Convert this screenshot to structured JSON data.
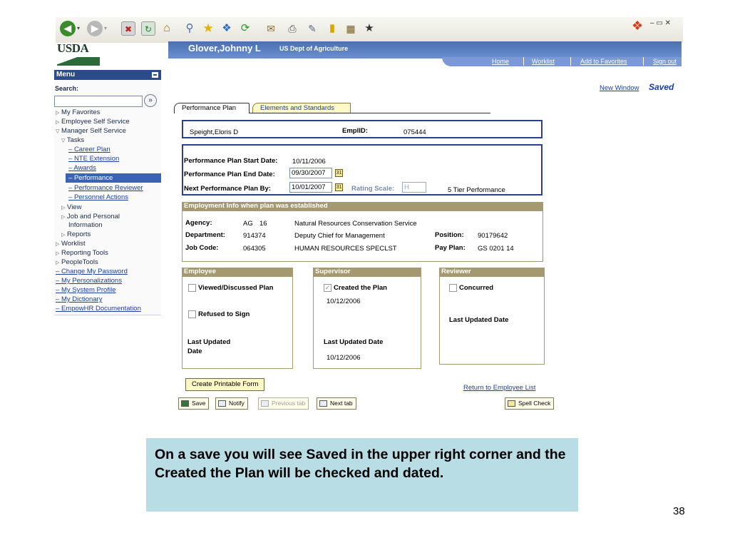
{
  "browser": {
    "back_label": "Back",
    "forward_label": "Forward"
  },
  "header": {
    "logo_text": "USDA",
    "user_name": "Glover,Johnny L",
    "org": "US Dept of Agriculture",
    "nav": [
      "Home",
      "Worklist",
      "Add to Favorites",
      "Sign out"
    ]
  },
  "menu": {
    "title": "Menu",
    "search_label": "Search:",
    "search_value": "",
    "items": {
      "my_favorites": "My Favorites",
      "employee_self_service": "Employee Self Service",
      "manager_self_service": "Manager Self Service",
      "tasks": "Tasks",
      "career_plan": "Career Plan",
      "nte_extension": "NTE Extension",
      "awards": "Awards",
      "performance": "Performance",
      "performance_reviewer": "Performance Reviewer",
      "personnel_actions": "Personnel Actions",
      "view": "View",
      "job_personal_1": "Job and Personal",
      "job_personal_2": "Information",
      "reports": "Reports",
      "worklist": "Worklist",
      "reporting_tools": "Reporting Tools",
      "peopletools": "PeopleTools",
      "change_password": "Change My Password",
      "my_personalizations": "My Personalizations",
      "my_system_profile": "My System Profile",
      "my_dictionary": "My Dictionary",
      "empowhr_doc": "EmpowHR Documentation"
    }
  },
  "top_right": {
    "new_window": "New Window",
    "saved": "Saved"
  },
  "tabs": {
    "performance_plan": "Performance Plan",
    "elements_standards": "Elements and Standards"
  },
  "employee_bar": {
    "name": "Speight,Eloris D",
    "emplid_label": "EmplID:",
    "emplid": "075444"
  },
  "plan": {
    "start_label": "Performance Plan Start Date:",
    "start_value": "10/11/2006",
    "end_label": "Performance Plan End Date:",
    "end_value": "09/30/2007",
    "next_label": "Next Performance Plan By:",
    "next_value": "10/01/2007",
    "rating_label": "Rating Scale:",
    "rating_value": "H",
    "rating_desc": "5 Tier Performance"
  },
  "employment": {
    "header": "Employment Info when plan was established",
    "agency_label": "Agency:",
    "agency_code": "AG",
    "agency_num": "16",
    "agency_name": "Natural Resources Conservation Service",
    "dept_label": "Department:",
    "dept_code": "914374",
    "dept_name": "Deputy Chief for Management",
    "position_label": "Position:",
    "position_value": "90179642",
    "jobcode_label": "Job Code:",
    "jobcode_value": "064305",
    "jobcode_name": "HUMAN RESOURCES SPECLST",
    "payplan_label": "Pay Plan:",
    "payplan_value": "GS  0201 14"
  },
  "employee_sect": {
    "header": "Employee",
    "viewed_label": "Viewed/Discussed Plan",
    "refused_label": "Refused to Sign",
    "last_updated_1": "Last Updated",
    "last_updated_2": "Date"
  },
  "supervisor_sect": {
    "header": "Supervisor",
    "created_label": "Created the Plan",
    "created_date": "10/12/2006",
    "last_updated": "Last Updated Date",
    "last_updated_value": "10/12/2006"
  },
  "reviewer_sect": {
    "header": "Reviewer",
    "concurred_label": "Concurred",
    "last_updated": "Last Updated Date"
  },
  "actions": {
    "create_printable": "Create Printable Form",
    "return_list": "Return to Employee List",
    "save": "Save",
    "notify": "Notify",
    "previous_tab": "Previous tab",
    "next_tab": "Next tab",
    "spell_check": "Spell Check"
  },
  "caption": "On a save you will see Saved in the upper right corner and the Created the Plan will be checked and dated.",
  "page_number": "38"
}
